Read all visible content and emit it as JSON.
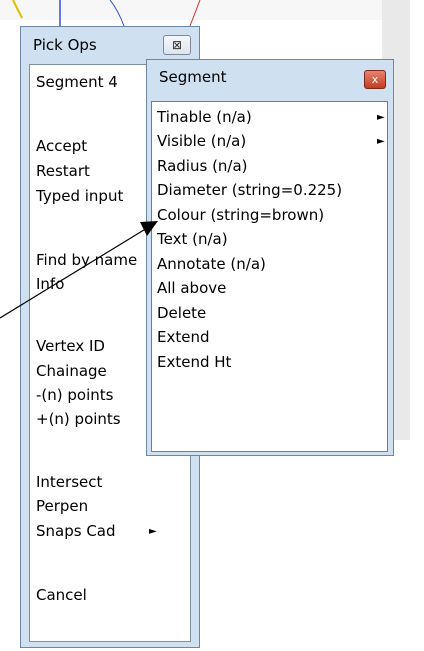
{
  "pick_ops": {
    "title": "Pick Ops",
    "close_glyph": "⊠",
    "items": [
      {
        "label": "Segment 4",
        "submenu": false
      },
      {
        "label": "Accept",
        "submenu": false
      },
      {
        "label": "Restart",
        "submenu": false
      },
      {
        "label": "Typed input",
        "submenu": false
      },
      {
        "label": "Find by name",
        "submenu": false
      },
      {
        "label": "Info",
        "submenu": false
      },
      {
        "label": "Vertex ID",
        "submenu": false
      },
      {
        "label": "Chainage",
        "submenu": false
      },
      {
        "label": "-(n) points",
        "submenu": false
      },
      {
        "label": "+(n) points",
        "submenu": false
      },
      {
        "label": "Intersect",
        "submenu": false
      },
      {
        "label": "Perpen",
        "submenu": false
      },
      {
        "label": "Snaps Cad",
        "submenu": true
      },
      {
        "label": "Cancel",
        "submenu": false
      }
    ],
    "submenu_glyph": "►"
  },
  "segment_menu": {
    "title": "Segment",
    "close_glyph": "x",
    "items": [
      {
        "label": "Tinable (n/a)",
        "submenu": true
      },
      {
        "label": "Visible (n/a)",
        "submenu": true
      },
      {
        "label": "Radius (n/a)",
        "submenu": false
      },
      {
        "label": "Diameter (string=0.225)",
        "submenu": false
      },
      {
        "label": "Colour (string=brown)",
        "submenu": false
      },
      {
        "label": "Text (n/a)",
        "submenu": false
      },
      {
        "label": "Annotate (n/a)",
        "submenu": false
      },
      {
        "label": "All above",
        "submenu": false
      },
      {
        "label": "Delete",
        "submenu": false
      },
      {
        "label": "Extend",
        "submenu": false
      },
      {
        "label": "Extend Ht",
        "submenu": false
      }
    ],
    "submenu_glyph": "►"
  },
  "colors": {
    "window_frame": "#cfe0f1",
    "close_red": "#c33c20"
  }
}
